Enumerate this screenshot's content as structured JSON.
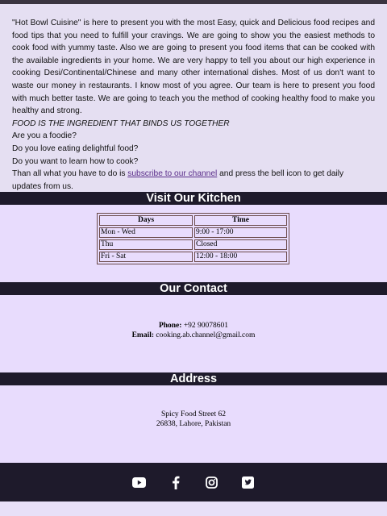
{
  "intro": {
    "paragraph": "\"Hot Bowl Cuisine\" is here to present you with the most Easy, quick and Delicious food recipes and food tips that you need to fulfill your cravings. We are going to show you the easiest methods to cook food with yummy taste. Also we are going to present you food items that can be cooked with the available ingredients in your home. We are very happy to tell you about our high experience in cooking Desi/Continental/Chinese and many other international dishes. Most of us don't want to waste our money in restaurants. I know most of you agree. Our team is here to present you food with much better taste. We are going to teach you the method of cooking healthy food to make you healthy and strong.",
    "tagline": "FOOD IS THE INGREDIENT THAT BINDS US TOGETHER",
    "q1": "Are you a foodie?",
    "q2": "Do you love eating delightful food?",
    "q3": "Do you want to learn how to cook?",
    "cta_before": "Than all what you have to do is ",
    "cta_link": "subscribe to our channel",
    "cta_after": " and press the bell icon to get daily updates from us."
  },
  "kitchen": {
    "title": "Visit Our Kitchen",
    "headers": [
      "Days",
      "Time"
    ],
    "rows": [
      [
        "Mon - Wed",
        "9:00 - 17:00"
      ],
      [
        "Thu",
        "Closed"
      ],
      [
        "Fri - Sat",
        "12:00 - 18:00"
      ]
    ]
  },
  "contact": {
    "title": "Our Contact",
    "phone_label": "Phone:",
    "phone": " +92 90078601",
    "email_label": "Email:",
    "email": " cooking.ab.channel@gmail.com"
  },
  "address": {
    "title": "Address",
    "line1": "Spicy Food Street 62",
    "line2": "26838, Lahore, Pakistan"
  },
  "footer": {
    "icons": [
      "youtube-icon",
      "facebook-icon",
      "instagram-icon",
      "twitter-icon"
    ]
  }
}
